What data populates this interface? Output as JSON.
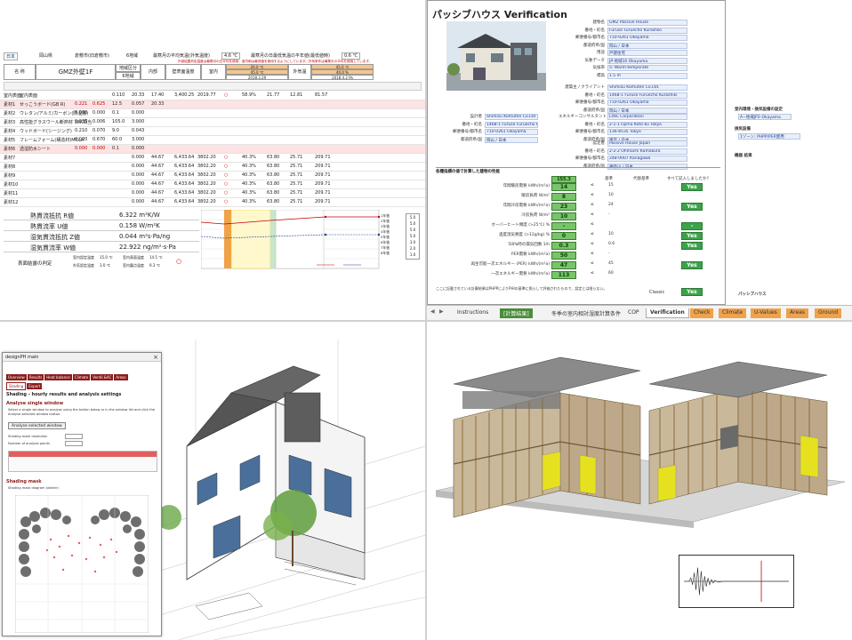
{
  "q1": {
    "top_row": [
      "日本",
      "岡山県",
      "倉敷市(旧倉敷市)",
      "6地域",
      "最寒月の平均気温(外気温度)",
      "4.6 ℃",
      "最寒月の日最低気温の平年値(最低値時)",
      "0.6 ℃"
    ],
    "note": "外部結露判定温度は最寒月の日平均を使用、室内側は最低値を使用するようにしています。外気条件は最寒月の平均を使用しています。",
    "title": "GMZ外壁1F",
    "headers": {
      "label": "名 称",
      "area": "地域区分",
      "area_val": "6地域",
      "inside": "内部",
      "inside2": "室内",
      "surface": "壁表面温度",
      "outdoor": "外気温",
      "temp_in": "26.0 ℃",
      "rh_in": "45.0 ℃",
      "temp_out": "45.0 ℃",
      "rh_out": "40.0 %",
      "dew1": "2018.3.29",
      "dew2": "2018.4.2 Pa"
    },
    "rows": [
      {
        "no": "室内表面",
        "name": "室内表面",
        "t": "",
        "g": "",
        "r": "0.110",
        "temp": "20.33",
        "c1": "17.40",
        "p": "3,400.25",
        "ps": "2019.77",
        "ok": "○",
        "rh": "58.9%",
        "x1": "21.77",
        "x2": "12.81",
        "x3": "81.57"
      },
      {
        "no": "素材1",
        "name": "せっこうボード(GB R)",
        "t": "0.221",
        "g": "0.625",
        "r": "12.5",
        "temp": "0.057",
        "c1": "20.33",
        "p": "",
        "ps": "",
        "ok": "",
        "rh": "",
        "x1": "",
        "x2": "",
        "x3": ""
      },
      {
        "no": "素材2",
        "name": "ウレタン/アルミ/カーボン(防湿層)",
        "t": "0.000",
        "g": "0.000",
        "r": "0.1",
        "temp": "0.000",
        "c1": "",
        "p": "",
        "ps": "",
        "ok": "",
        "rh": "",
        "x1": "",
        "x2": "",
        "x3": ""
      },
      {
        "no": "素材3",
        "name": "高性能グラスウール断熱材 16K相当",
        "t": "0.035",
        "g": "0.006",
        "r": "105.0",
        "temp": "3.000",
        "c1": "",
        "p": "",
        "ps": "",
        "ok": "",
        "rh": "",
        "x1": "",
        "x2": "",
        "x3": ""
      },
      {
        "no": "素材4",
        "name": "ウッドボード(シージング)",
        "t": "0.210",
        "g": "0.070",
        "r": "9.0",
        "temp": "0.043",
        "c1": "",
        "p": "",
        "ps": "",
        "ok": "",
        "rh": "",
        "x1": "",
        "x2": "",
        "x3": ""
      },
      {
        "no": "素材5",
        "name": "フレームフォーム(構造材)MCLA",
        "t": "0.020",
        "g": "0.670",
        "r": "60.0",
        "temp": "3.000",
        "c1": "",
        "p": "",
        "ps": "",
        "ok": "",
        "rh": "",
        "x1": "",
        "x2": "",
        "x3": ""
      },
      {
        "no": "素材6",
        "name": "透湿防水シート",
        "t": "0.000",
        "g": "0.000",
        "r": "0.1",
        "temp": "0.000",
        "c1": "",
        "p": "",
        "ps": "",
        "ok": "",
        "rh": "",
        "x1": "",
        "x2": "",
        "x3": ""
      },
      {
        "no": "素材7",
        "name": "",
        "t": "",
        "g": "",
        "r": "",
        "temp": "0.000",
        "c1": "44.67",
        "p": "6,433.64",
        "ps": "3802.20",
        "ok": "○",
        "rh": "40.3%",
        "x1": "63.80",
        "x2": "25.71",
        "x3": "209.71"
      },
      {
        "no": "素材8",
        "name": "",
        "t": "",
        "g": "",
        "r": "",
        "temp": "0.000",
        "c1": "44.67",
        "p": "6,433.64",
        "ps": "3802.20",
        "ok": "○",
        "rh": "40.3%",
        "x1": "63.80",
        "x2": "25.71",
        "x3": "209.71"
      },
      {
        "no": "素材9",
        "name": "",
        "t": "",
        "g": "",
        "r": "",
        "temp": "0.000",
        "c1": "44.67",
        "p": "6,433.64",
        "ps": "3802.20",
        "ok": "○",
        "rh": "40.3%",
        "x1": "63.80",
        "x2": "25.71",
        "x3": "209.71"
      },
      {
        "no": "素材10",
        "name": "",
        "t": "",
        "g": "",
        "r": "",
        "temp": "0.000",
        "c1": "44.67",
        "p": "6,433.64",
        "ps": "3802.20",
        "ok": "○",
        "rh": "40.3%",
        "x1": "63.80",
        "x2": "25.71",
        "x3": "209.71"
      },
      {
        "no": "素材11",
        "name": "",
        "t": "",
        "g": "",
        "r": "",
        "temp": "0.000",
        "c1": "44.67",
        "p": "6,433.64",
        "ps": "3802.20",
        "ok": "○",
        "rh": "40.3%",
        "x1": "63.80",
        "x2": "25.71",
        "x3": "209.71"
      },
      {
        "no": "素材12",
        "name": "",
        "t": "",
        "g": "",
        "r": "",
        "temp": "0.000",
        "c1": "44.67",
        "p": "6,433.64",
        "ps": "3802.20",
        "ok": "○",
        "rh": "40.3%",
        "x1": "63.80",
        "x2": "25.71",
        "x3": "209.71"
      }
    ],
    "results": [
      {
        "label": "熱貫流抵抗 R値",
        "value": "6.322 m²K/W"
      },
      {
        "label": "熱貫流率 U値",
        "value": "0.158 W/m²K"
      },
      {
        "label": "湿気貫流抵抗 Z値",
        "value": "0.044 m²s·Pa/ng"
      },
      {
        "label": "湿気貫流率 W値",
        "value": "22.922 ng/m²·s·Pa"
      }
    ],
    "condensation": {
      "label": "表面結露の判定",
      "a": "室内設定温度",
      "a_val": "15.0 ℃",
      "b": "室内表面温度",
      "b_val": "14.5 ℃",
      "c": "外気設定温度",
      "c_val": "3.0 ℃",
      "d": "室内露点温度",
      "d_val": "9.3 ℃"
    },
    "chart_legend": [
      "1年後",
      "2年後",
      "3年後",
      "4年後",
      "5年後",
      "6年後",
      "7年後",
      "8年後"
    ],
    "chart_ticks": [
      "5.0",
      "5.0",
      "5.0",
      "5.0",
      "3.0",
      "2.0",
      "1.0"
    ]
  },
  "q2": {
    "title": "パッシブハウス Verification",
    "project": [
      {
        "l": "建物名",
        "v": "GMZ Passive House"
      },
      {
        "l": "番地・町名",
        "v": "Furuse Furuecho Kurashiki"
      },
      {
        "l": "郵便番号/都市名",
        "v": "710-0261    Okayama"
      },
      {
        "l": "都道府県/国",
        "v": "岡山 / 日本"
      },
      {
        "l": "用途",
        "v": "戸建住宅"
      },
      {
        "l": "気象データ",
        "v": "JP-地域10 Okayama"
      },
      {
        "l": "気候帯",
        "v": "5: Warm-temperate"
      },
      {
        "l": "標高",
        "v": "1.5 m"
      }
    ],
    "client": [
      {
        "l": "建築主 / クライアント",
        "v": "Shimizu Komuten Co.Ltd."
      },
      {
        "l": "番地・町名",
        "v": "1468-1 Furuse Furuecho Kurashiki"
      },
      {
        "l": "郵便番号/都市名",
        "v": "710-0261    Okayama"
      },
      {
        "l": "都道府県/国",
        "v": "岡山 / 日本"
      }
    ],
    "designer": [
      {
        "l": "設計者",
        "v": "Shimizu Komuten Co.Ltd."
      },
      {
        "l": "番地・町名",
        "v": "1468-1 Furuse Furuecho Kurashiki"
      },
      {
        "l": "郵便番号/都市名",
        "v": "710-0261    Okayama"
      },
      {
        "l": "都道府県/国",
        "v": "岡山 / 日本"
      }
    ],
    "energy": [
      {
        "l": "エネルギーコンサルタント",
        "v": "LIXIL Corporation"
      },
      {
        "l": "番地・町名",
        "v": "2-1-1 Ojima Koto-ku Tokyo"
      },
      {
        "l": "郵便番号/都市名",
        "v": "136-8535    Tokyo"
      },
      {
        "l": "都道府県/国",
        "v": "東京 / 日本"
      }
    ],
    "certifier": [
      {
        "l": "認定者",
        "v": "Passive House Japan"
      },
      {
        "l": "番地・町名",
        "v": "2-2-2 Ohmachi Kamakura"
      },
      {
        "l": "郵便番号/都市名",
        "v": "248-0007    Kanagawa"
      },
      {
        "l": "都道府県/国",
        "v": "神奈川 / 日本"
      }
    ],
    "other_builder": {
      "l": "設計者/登録番号",
      "v": "plan/Libre Co.Ltd."
    },
    "checks": [
      {
        "l": "年間暖房需要 kWh/(m²a)",
        "v": "14",
        "c": "15",
        "yes": "Yes"
      },
      {
        "l": "暖房負荷 W/m²",
        "v": "8",
        "c": "10",
        "yes": ""
      },
      {
        "l": "年間冷房需要 kWh/(m²a)",
        "v": "23",
        "c": "24",
        "yes": "Yes"
      },
      {
        "l": "冷房負荷 W/m²",
        "v": "10",
        "c": "-",
        "yes": ""
      },
      {
        "l": "オーバーヒート頻度 (>25℃) %",
        "v": "-",
        "c": "",
        "yes": "-"
      },
      {
        "l": "過度湿気頻度 (>12g/kg) %",
        "v": "0",
        "c": "10",
        "yes": "Yes"
      },
      {
        "l": "50Pa時の漏気回数 1/h",
        "v": "0.3",
        "c": "0.6",
        "yes": "Yes"
      },
      {
        "l": "PER需要 kWh/(m²a)",
        "v": "50",
        "c": "-",
        "yes": ""
      },
      {
        "l": "再生可能一次エネルギー (PER) kWh/(m²a)",
        "v": "47",
        "c": "45",
        "yes": "Yes"
      },
      {
        "l": "一次エネルギー需要 kWh/(m²a)",
        "v": "113",
        "c": "60",
        "yes": ""
      }
    ],
    "area": "155.3",
    "section_title": "各種指標の値で計算した建物の性能",
    "criteria_hdr": [
      "基準",
      "代替基準",
      "すべて記入しましたか?"
    ],
    "bottom_text": "ここに記載されている計算結果はPHPPによりPHIの基準に照らして評価されたもので、認定とは限らない。",
    "classic": "Classic",
    "classic_yes": "Yes",
    "tabs": [
      "Instructions",
      "[計算結果]",
      "冬季の室内相対湿度計算条件",
      "COP",
      "Verification",
      "Check",
      "Climate",
      "U-Values",
      "Areas",
      "Ground"
    ],
    "right_labels": [
      "室内環境・換気設備の設定",
      "換気設備",
      "機器 結果",
      "パッシブハウス"
    ],
    "right_values": [
      "A−地域JP2-Okayama",
      "1ゾーン: PHPP/PER使用",
      "パッシブハウス"
    ]
  },
  "q3": {
    "window_title": "designPH main",
    "tabs": [
      "Overview",
      "Results",
      "Heat balance",
      "Climate",
      "Ventil.&AC",
      "Areas",
      "Shading",
      "Export"
    ],
    "section1": "Shading - hourly results and analysis settings",
    "section2": "Analyse single window",
    "desc": "Select a single window to analyse using the button below or in the window list and click the Analyse selected window button.",
    "button": "Analyse selected window",
    "shading_res": "Shading mask resolution",
    "num_items": "Number of analysis points",
    "section3": "Shading mask",
    "mask_title": "Shading mask diagram (winter)"
  },
  "colors": {
    "accent_red": "#8b1c1c",
    "yes_green": "#3da34b",
    "orange": "#f0a24a"
  }
}
